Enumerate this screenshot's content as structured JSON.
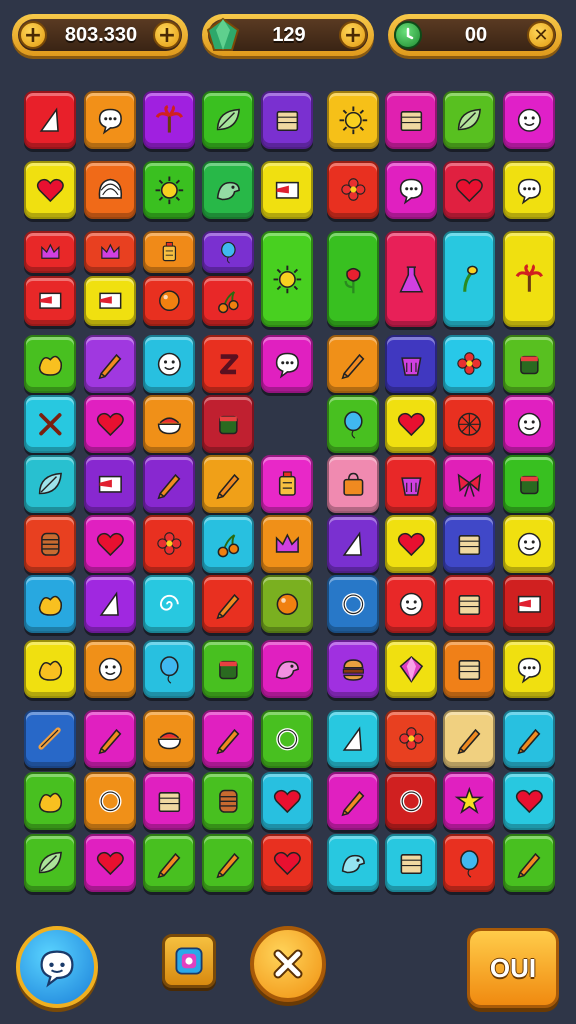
{
  "hud": {
    "coins": {
      "value": "803.330",
      "left_icon": "plus-icon",
      "add_icon": "plus-icon"
    },
    "gems": {
      "value": "129",
      "icon": "green-gem-icon",
      "add_icon": "plus-icon"
    },
    "timer": {
      "value": "00",
      "icon": "green-clock-icon",
      "close_icon": "close-icon"
    }
  },
  "board": {
    "tiles": [
      {
        "color": "#e8202a",
        "icon": "sail"
      },
      {
        "color": "#f29018",
        "icon": "speech"
      },
      {
        "color": "#a020e0",
        "icon": "palm"
      },
      {
        "color": "#3ac020",
        "icon": "leaf"
      },
      {
        "color": "#7a30d0",
        "icon": "box"
      },
      {
        "color": "#f6c018",
        "icon": "sun"
      },
      {
        "color": "#e020b0",
        "icon": "box"
      },
      {
        "color": "#58c020",
        "icon": "leaf"
      },
      {
        "color": "#e020c8",
        "icon": "face"
      },
      {
        "color": "#f0e010",
        "icon": "heart"
      },
      {
        "color": "#f06a18",
        "icon": "shell"
      },
      {
        "color": "#3ac020",
        "icon": "sun"
      },
      {
        "color": "#28b848",
        "icon": "bird"
      },
      {
        "color": "#f0e010",
        "icon": "flag"
      },
      {
        "color": "#e83020",
        "icon": "flower"
      },
      {
        "color": "#e020c0",
        "icon": "speech"
      },
      {
        "color": "#e02040",
        "icon": "heart"
      },
      {
        "color": "#f0e010",
        "icon": "speech"
      },
      {
        "color": "#e82828",
        "icon": "crown"
      },
      {
        "color": "#e84020",
        "icon": "crown"
      },
      {
        "color": "#f08a18",
        "icon": "lantern"
      },
      {
        "color": "#7a30d0",
        "icon": "balloon"
      },
      {
        "color": "#48d020",
        "icon": "sun"
      },
      {
        "color": "#38c020",
        "icon": "rose"
      },
      {
        "color": "#e82058",
        "icon": "flask"
      },
      {
        "color": "#28c8e0",
        "icon": "stem"
      },
      {
        "color": "#f0e010",
        "icon": "palm"
      },
      {
        "color": "#e82828",
        "icon": "flag"
      },
      {
        "color": "#f0e010",
        "icon": "flag"
      },
      {
        "color": "#e83020",
        "icon": "orb"
      },
      {
        "color": "#e82828",
        "icon": "cherry"
      },
      {
        "color": "#48c020",
        "icon": "splash"
      },
      {
        "color": "#a038e0",
        "icon": "pencil"
      },
      {
        "color": "#28c0e0",
        "icon": "face"
      },
      {
        "color": "#e83020",
        "icon": "zigzag"
      },
      {
        "color": "#e020c0",
        "icon": "speech"
      },
      {
        "color": "#f09018",
        "icon": "pencil"
      },
      {
        "color": "#4038c0",
        "icon": "bucket"
      },
      {
        "color": "#28c8e8",
        "icon": "flower"
      },
      {
        "color": "#58c020",
        "icon": "cup"
      },
      {
        "color": "#28c8e0",
        "icon": "cross"
      },
      {
        "color": "#e020c0",
        "icon": "heart"
      },
      {
        "color": "#f09018",
        "icon": "bowl"
      },
      {
        "color": "#c02030",
        "icon": "cup"
      },
      {
        "color": "#48c020",
        "icon": "balloon"
      },
      {
        "color": "#f0e010",
        "icon": "heart"
      },
      {
        "color": "#e83020",
        "icon": "ball"
      },
      {
        "color": "#e020c0",
        "icon": "face"
      },
      {
        "color": "#28c0d0",
        "icon": "leaf"
      },
      {
        "color": "#8828d0",
        "icon": "flag"
      },
      {
        "color": "#8828d0",
        "icon": "pencil"
      },
      {
        "color": "#f0a018",
        "icon": "pencil"
      },
      {
        "color": "#e828c8",
        "icon": "lantern"
      },
      {
        "color": "#f08ab0",
        "icon": "bag"
      },
      {
        "color": "#e82828",
        "icon": "bucket"
      },
      {
        "color": "#e020b8",
        "icon": "bow"
      },
      {
        "color": "#38c020",
        "icon": "cup"
      },
      {
        "color": "#e84020",
        "icon": "barrel"
      },
      {
        "color": "#e020c0",
        "icon": "heart"
      },
      {
        "color": "#e83020",
        "icon": "flower"
      },
      {
        "color": "#28c0e0",
        "icon": "cherry"
      },
      {
        "color": "#f09018",
        "icon": "crown"
      },
      {
        "color": "#7a30d0",
        "icon": "sail"
      },
      {
        "color": "#f0e010",
        "icon": "heart"
      },
      {
        "color": "#4048c8",
        "icon": "box"
      },
      {
        "color": "#f0e010",
        "icon": "face"
      },
      {
        "color": "#28a8e0",
        "icon": "splash"
      },
      {
        "color": "#a028e0",
        "icon": "sail"
      },
      {
        "color": "#28c8e0",
        "icon": "spiral"
      },
      {
        "color": "#e83020",
        "icon": "pencil"
      },
      {
        "color": "#7ab020",
        "icon": "orb"
      },
      {
        "color": "#2878c8",
        "icon": "ring"
      },
      {
        "color": "#e82828",
        "icon": "face"
      },
      {
        "color": "#e82828",
        "icon": "box"
      },
      {
        "color": "#d02020",
        "icon": "flag"
      },
      {
        "color": "#f0e010",
        "icon": "splash"
      },
      {
        "color": "#f09018",
        "icon": "face"
      },
      {
        "color": "#28c0e0",
        "icon": "balloon"
      },
      {
        "color": "#48c020",
        "icon": "cup"
      },
      {
        "color": "#e020c0",
        "icon": "bird"
      },
      {
        "color": "#a030e0",
        "icon": "burger"
      },
      {
        "color": "#f0e010",
        "icon": "gem"
      },
      {
        "color": "#f08018",
        "icon": "box"
      },
      {
        "color": "#f0e010",
        "icon": "speech"
      },
      {
        "color": "#2868c8",
        "icon": "stick"
      },
      {
        "color": "#e020c0",
        "icon": "pencil"
      },
      {
        "color": "#f09018",
        "icon": "bowl"
      },
      {
        "color": "#e020c0",
        "icon": "pencil"
      },
      {
        "color": "#48c020",
        "icon": "ring"
      },
      {
        "color": "#28c8e0",
        "icon": "sail"
      },
      {
        "color": "#e84020",
        "icon": "flower"
      },
      {
        "color": "#f0d080",
        "icon": "pencil"
      },
      {
        "color": "#28c0e0",
        "icon": "pencil"
      },
      {
        "color": "#48c020",
        "icon": "splash"
      },
      {
        "color": "#f09018",
        "icon": "ring"
      },
      {
        "color": "#e020c0",
        "icon": "box"
      },
      {
        "color": "#48c020",
        "icon": "barrel"
      },
      {
        "color": "#28c0e0",
        "icon": "heart"
      },
      {
        "color": "#e020c0",
        "icon": "pencil"
      },
      {
        "color": "#d02020",
        "icon": "ring"
      },
      {
        "color": "#e020c0",
        "icon": "star"
      },
      {
        "color": "#28c8e0",
        "icon": "heart"
      },
      {
        "color": "#48c020",
        "icon": "leaf"
      },
      {
        "color": "#e020c0",
        "icon": "heart"
      },
      {
        "color": "#48c020",
        "icon": "pencil"
      },
      {
        "color": "#48c020",
        "icon": "pencil"
      },
      {
        "color": "#e83020",
        "icon": "heart"
      },
      {
        "color": "#28c8e0",
        "icon": "bird"
      },
      {
        "color": "#28c8e0",
        "icon": "box"
      },
      {
        "color": "#e83020",
        "icon": "balloon"
      },
      {
        "color": "#48c020",
        "icon": "pencil"
      }
    ]
  },
  "bottom_bar": {
    "chat_icon": "speech-bubble-icon",
    "shuffle_icon": "shuffle-icon",
    "cancel_icon": "close-icon",
    "confirm_label": "OUI"
  }
}
